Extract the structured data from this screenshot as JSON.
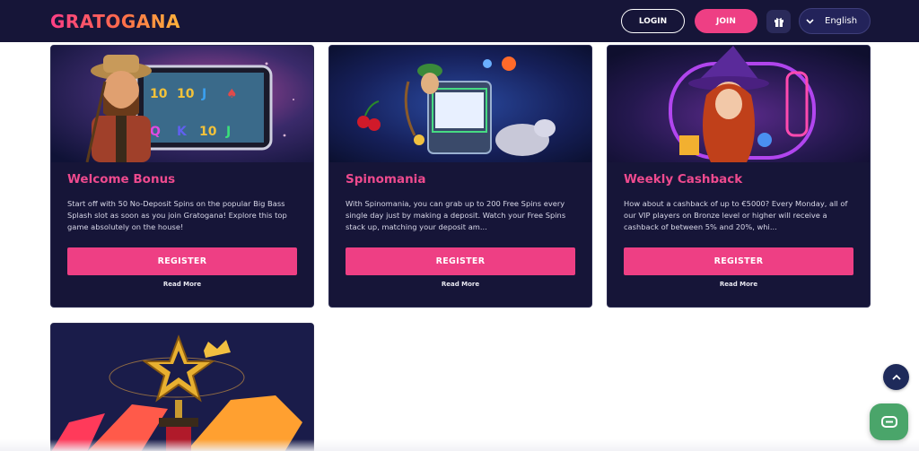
{
  "header": {
    "logo_text": "GRATOGANA",
    "login_label": "LOGIN",
    "join_label": "JOIN",
    "gift_icon": "gift-icon",
    "language": "English"
  },
  "cards": [
    {
      "title": "Welcome Bonus",
      "description": "Start off with 50 No-Deposit Spins on the popular Big Bass Splash slot as soon as you join Gratogana! Explore this top game absolutely on the house!",
      "register_label": "REGISTER",
      "read_more_label": "Read More",
      "image": "fisherman-slot-image"
    },
    {
      "title": "Spinomania",
      "description": "With Spinomania, you can grab up to 200 Free Spins every single day just by making a deposit. Watch your Free Spins stack up, matching your deposit am...",
      "register_label": "REGISTER",
      "read_more_label": "Read More",
      "image": "archer-slot-machine-image"
    },
    {
      "title": "Weekly Cashback",
      "description": "How about a cashback of up to €5000? Every Monday, all of our VIP players on Bronze level or higher will receive a cashback of between 5% and 20%, whi...",
      "register_label": "REGISTER",
      "read_more_label": "Read More",
      "image": "witch-slot-image"
    },
    {
      "title": "",
      "image": "gold-star-trophy-image"
    }
  ],
  "colors": {
    "header_bg": "#161538",
    "card_bg": "#161538",
    "accent_pink": "#ee3f84",
    "title_pink": "#ee4a8e",
    "chat_green": "#4aa56a"
  },
  "floating": {
    "scroll_top_icon": "chevron-up-icon",
    "chat_icon": "chat-bubble-icon"
  }
}
